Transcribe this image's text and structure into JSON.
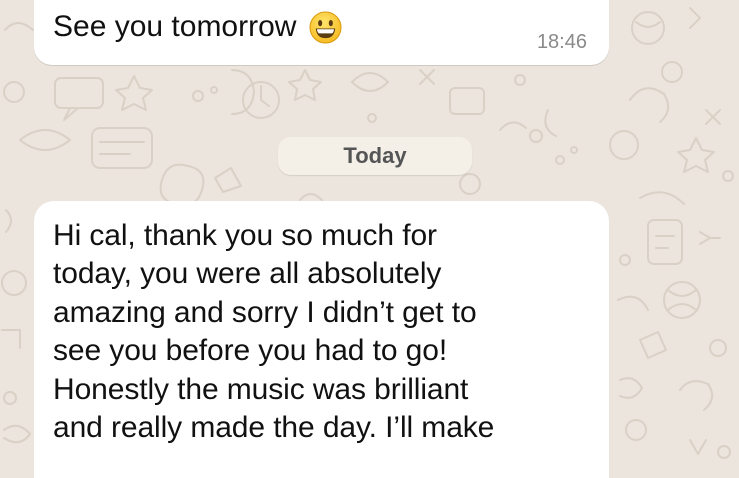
{
  "chat": {
    "previous_message": {
      "text": "See you tomorrow",
      "emoji": "grinning-face-emoji",
      "time": "18:46"
    },
    "date_divider": "Today",
    "incoming_message": {
      "lines": [
        "Hi cal, thank you so much for",
        "today, you were all absolutely",
        "amazing and sorry I didn’t get to",
        "see you before you had to go!",
        "Honestly the music was brilliant",
        "and really made the day. I’ll make"
      ]
    }
  },
  "colors": {
    "wallpaper": "#ece5dd",
    "bubble": "#ffffff",
    "date_pill": "#f4f0e8",
    "timestamp": "#8a8a8a"
  }
}
